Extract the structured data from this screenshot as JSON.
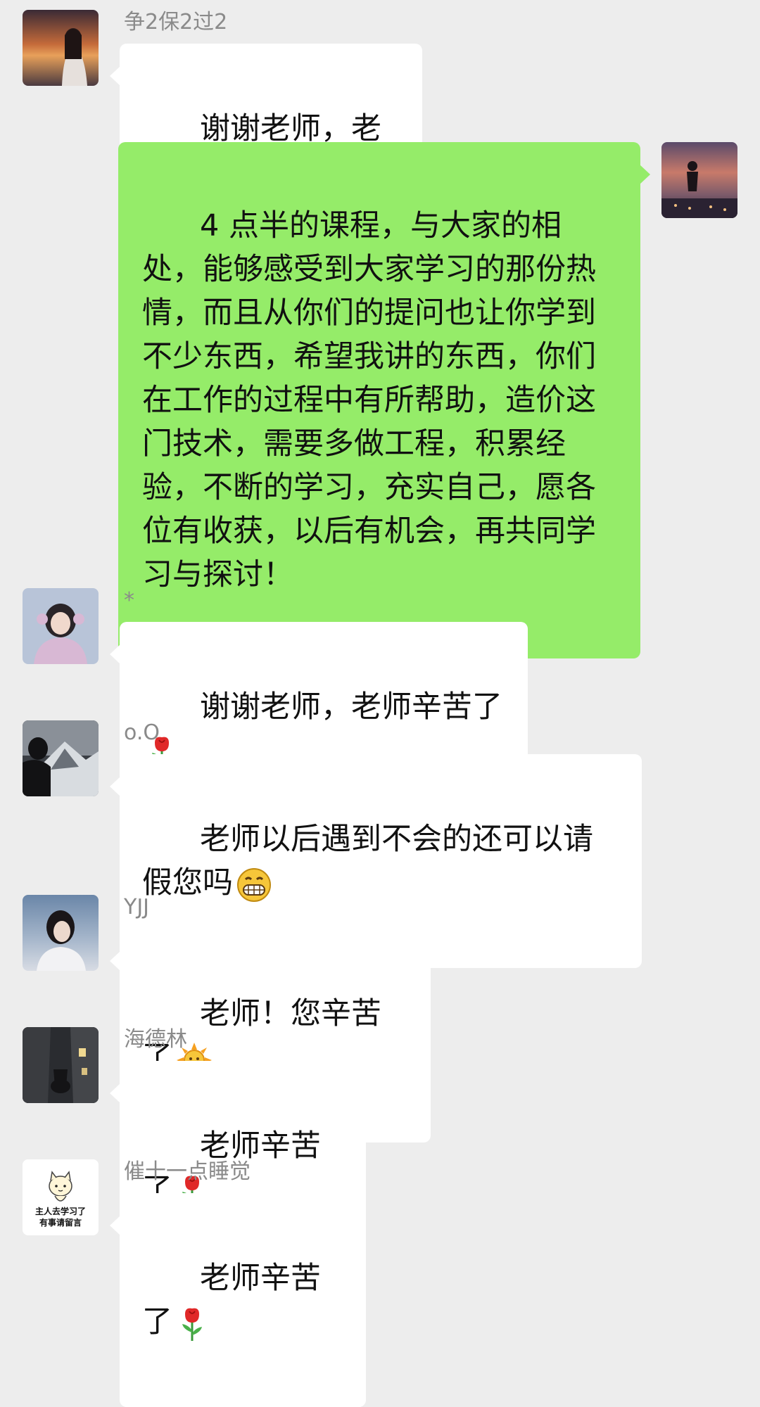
{
  "messages": [
    {
      "name": "争2保2过2",
      "text": "谢谢老师，老师辛苦了",
      "emoji": ""
    },
    {
      "self": true,
      "text": "4 点半的课程，与大家的相处，能够感受到大家学习的那份热情，而且从你们的提问也让你学到不少东西，希望我讲的东西，你们在工作的过程中有所帮助，造价这门技术，需要多做工程，积累经验，不断的学习，充实自己，愿各位有收获，以后有机会，再共同学习与探讨！"
    },
    {
      "name": "*",
      "text": "谢谢老师，老师辛苦了",
      "emoji": "rose-icon"
    },
    {
      "name": "o.O",
      "text": "老师以后遇到不会的还可以请假您吗",
      "emoji": "grin-icon"
    },
    {
      "name": "YJJ",
      "text": "老师！您辛苦了",
      "emoji": "sun-icon"
    },
    {
      "name": "海德林",
      "text": "老师辛苦了",
      "emoji": "rose-icon"
    },
    {
      "name": "催十一点睡觉",
      "text": "老师辛苦了",
      "emoji": "rose-icon"
    }
  ],
  "avatars": {
    "sticker_text_line1": "主人去学习了",
    "sticker_text_line2": "有事请留言"
  },
  "colors": {
    "background": "#ededed",
    "bubble_white": "#ffffff",
    "bubble_green": "#95ec69",
    "name_gray": "#8a8a8a"
  }
}
